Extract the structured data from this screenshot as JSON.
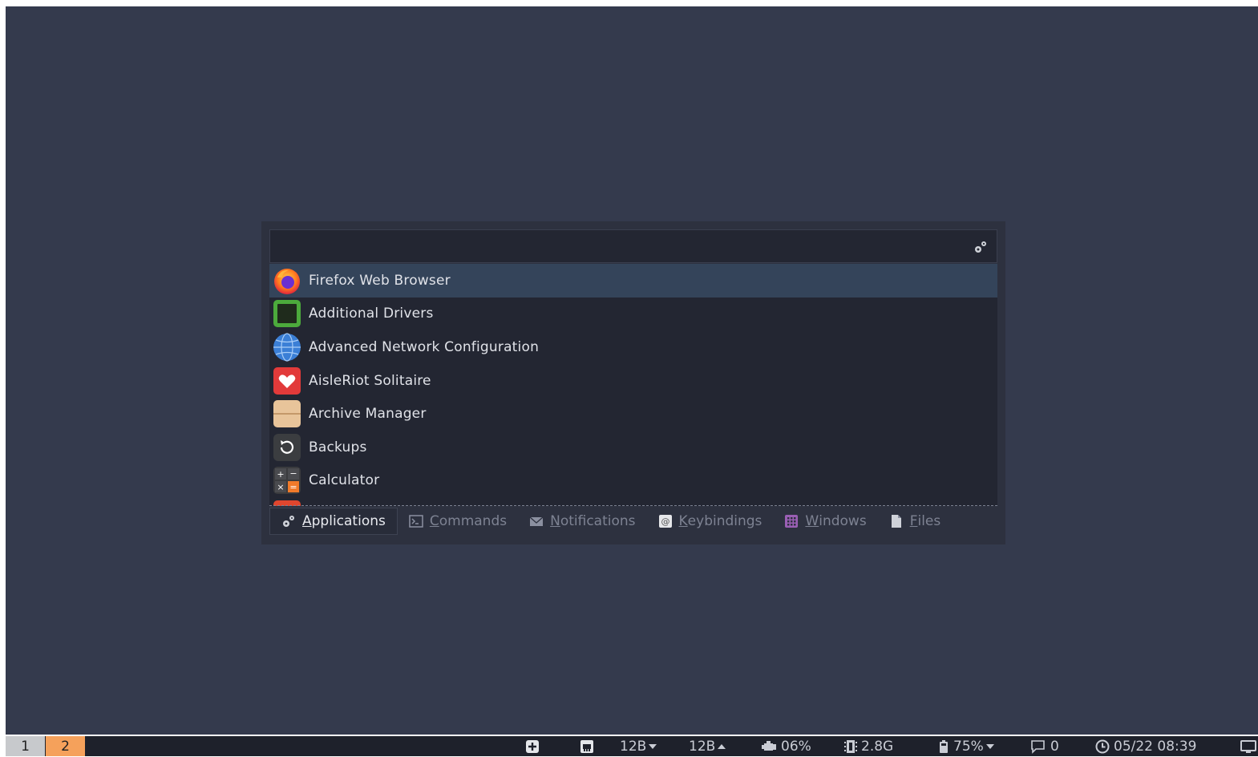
{
  "launcher": {
    "search": {
      "value": "",
      "placeholder": ""
    },
    "items": [
      {
        "label": "Firefox Web Browser",
        "icon": "firefox-icon"
      },
      {
        "label": "Additional Drivers",
        "icon": "chip-icon"
      },
      {
        "label": "Advanced Network Configuration",
        "icon": "network-globe-icon"
      },
      {
        "label": "AisleRiot Solitaire",
        "icon": "heart-card-icon"
      },
      {
        "label": "Archive Manager",
        "icon": "archive-box-icon"
      },
      {
        "label": "Backups",
        "icon": "backup-icon"
      },
      {
        "label": "Calculator",
        "icon": "calculator-icon"
      }
    ],
    "selected_index": 0,
    "modes": [
      {
        "key": "A",
        "rest": "pplications",
        "icon": "gears-icon",
        "active": true
      },
      {
        "key": "C",
        "rest": "ommands",
        "icon": "terminal-icon",
        "active": false
      },
      {
        "key": "N",
        "rest": "otifications",
        "icon": "envelope-icon",
        "active": false
      },
      {
        "key": "K",
        "rest": "eybindings",
        "icon": "at-icon",
        "active": false
      },
      {
        "key": "W",
        "rest": "indows",
        "icon": "grid-icon",
        "active": false
      },
      {
        "key": "F",
        "rest": "iles",
        "icon": "file-icon",
        "active": false
      }
    ]
  },
  "panel": {
    "workspaces": [
      "1",
      "2"
    ],
    "active_workspace": "2",
    "net_down": "12B",
    "net_up": "12B",
    "cpu": "06%",
    "memory": "2.8G",
    "battery": "75%",
    "notifications": "0",
    "datetime": "05/22 08:39"
  },
  "colors": {
    "desktop": "#343a4d",
    "selected_row": "#34445a",
    "active_workspace": "#f5a15b"
  }
}
